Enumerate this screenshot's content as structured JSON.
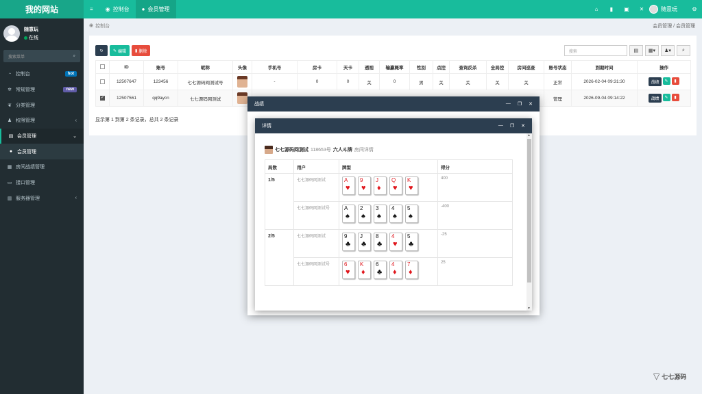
{
  "app": {
    "title": "我的网站"
  },
  "topnav": {
    "menu_icon": "≡",
    "tabs": [
      {
        "label": "控制台",
        "icon": "dashboard-icon"
      },
      {
        "label": "会员管理",
        "icon": "user-icon"
      }
    ],
    "user_name": "随意玩"
  },
  "sidebar": {
    "user_name": "随意玩",
    "status": "在线",
    "search_placeholder": "搜索菜单",
    "items": [
      {
        "label": "控制台",
        "badge": "hot"
      },
      {
        "label": "常规管理",
        "badge": "new"
      },
      {
        "label": "分类管理"
      },
      {
        "label": "权限管理",
        "chevron": "‹"
      },
      {
        "label": "会员管理",
        "chevron": "⌄"
      },
      {
        "label": "会员管理"
      },
      {
        "label": "房间战绩管理"
      },
      {
        "label": "接口管理"
      },
      {
        "label": "服务器管理",
        "chevron": "‹"
      }
    ]
  },
  "breadcrumb": {
    "home": "控制台",
    "right_1": "会员管理",
    "sep": "/",
    "right_2": "会员管理"
  },
  "toolbar": {
    "edit_label": "编辑",
    "delete_label": "删除",
    "search_placeholder": "搜索"
  },
  "table": {
    "headers": [
      "ID",
      "账号",
      "昵称",
      "头像",
      "手机号",
      "房卡",
      "天卡",
      "透视",
      "输赢概率",
      "性别",
      "点控",
      "查询反杀",
      "全局控",
      "房间巡查",
      "账号状态",
      "到期时间",
      "操作"
    ],
    "rows": [
      {
        "id": "12507647",
        "account": "123456",
        "nick": "七七源码网测试号",
        "phone": "-",
        "card": "0",
        "day": "0",
        "see": "关",
        "prob": "0",
        "sex": "男",
        "ctrl": "关",
        "check": "关",
        "global": "关",
        "patrol": "关",
        "state": "正常",
        "expire": "2026-02-04 09:31:30"
      },
      {
        "id": "12507561",
        "account": "qq9aycn",
        "nick": "七七源码网测试",
        "state": "管理",
        "expire": "2026-09-04 09:14:22"
      }
    ],
    "op_label": "战绩",
    "pager": "显示第 1 到第 2 条记录，总共 2 条记录"
  },
  "modal_outer": {
    "title": "战绩"
  },
  "modal_inner": {
    "title": "详情",
    "game": {
      "name": "七七源码网测试",
      "room": "118653号",
      "mode": "六人斗牌",
      "suffix": "房间详情"
    },
    "headers": [
      "局数",
      "用户",
      "牌型",
      "得分"
    ],
    "rounds": [
      {
        "round": "1/5",
        "players": [
          {
            "user": "七七源码网测试",
            "score": "400",
            "cards": [
              [
                "A",
                "♥",
                "red"
              ],
              [
                "9",
                "♥",
                "red"
              ],
              [
                "J",
                "♦",
                "red"
              ],
              [
                "Q",
                "♥",
                "red"
              ],
              [
                "K",
                "♥",
                "red"
              ]
            ]
          },
          {
            "user": "七七源码网测试号",
            "score": "-400",
            "cards": [
              [
                "A",
                "♠",
                "black"
              ],
              [
                "2",
                "♠",
                "black"
              ],
              [
                "3",
                "♠",
                "black"
              ],
              [
                "4",
                "♠",
                "black"
              ],
              [
                "5",
                "♠",
                "black"
              ]
            ]
          }
        ]
      },
      {
        "round": "2/5",
        "players": [
          {
            "user": "七七源码网测试",
            "score": "-25",
            "cards": [
              [
                "9",
                "♣",
                "black"
              ],
              [
                "J",
                "♣",
                "black"
              ],
              [
                "8",
                "♣",
                "black"
              ],
              [
                "4",
                "♥",
                "red"
              ],
              [
                "5",
                "♣",
                "black"
              ]
            ]
          },
          {
            "user": "七七源码网测试号",
            "score": "25",
            "cards": [
              [
                "6",
                "♥",
                "red"
              ],
              [
                "K",
                "♦",
                "red"
              ],
              [
                "6",
                "♣",
                "black"
              ],
              [
                "4",
                "♦",
                "red"
              ],
              [
                "7",
                "♦",
                "red"
              ]
            ]
          }
        ]
      }
    ]
  },
  "watermark": {
    "text": "七七源码"
  },
  "colors": {
    "brand": "#18bc9c",
    "dark": "#2c3e50",
    "danger": "#e74c3c",
    "sidebar": "#222d32"
  }
}
